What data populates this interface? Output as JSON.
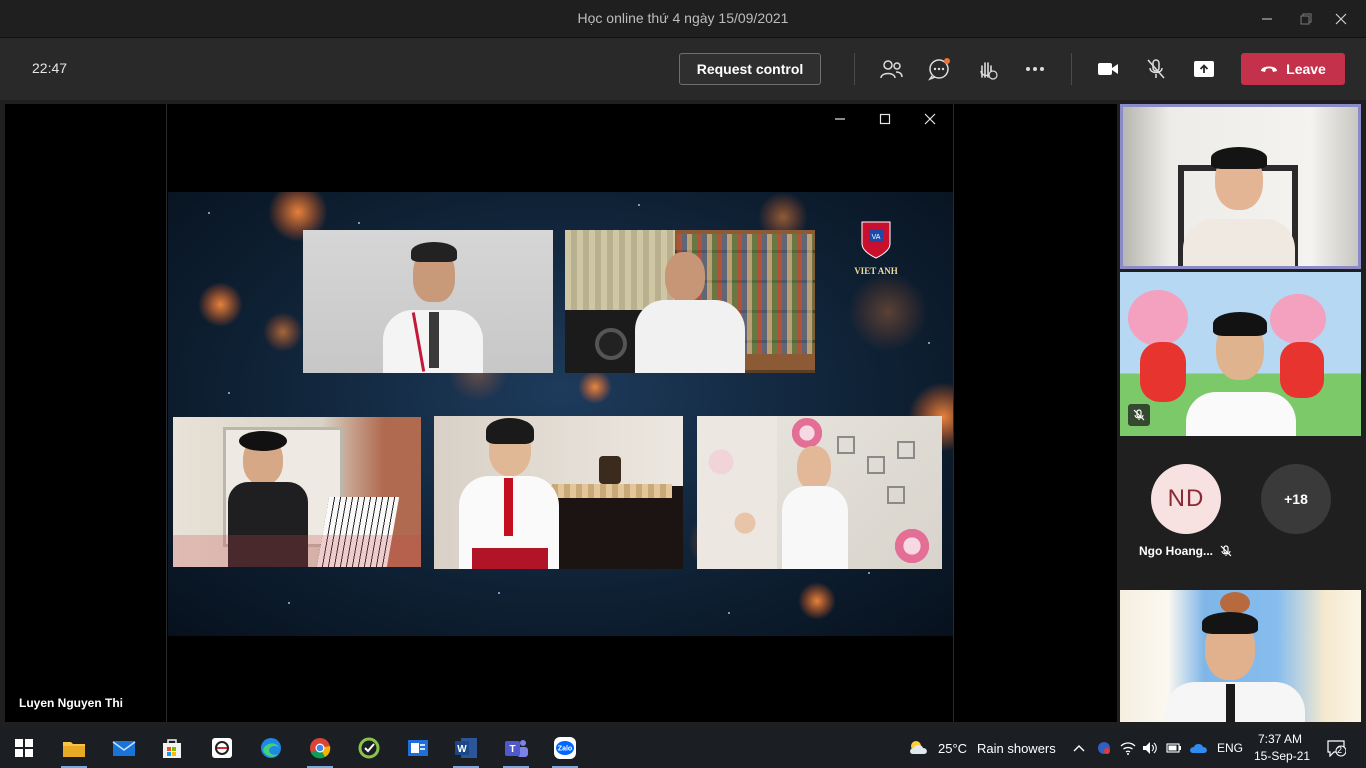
{
  "window": {
    "title": "Học online thứ 4 ngày 15/09/2021"
  },
  "toolbar": {
    "timer": "22:47",
    "request_control_label": "Request control",
    "leave_label": "Leave"
  },
  "stage": {
    "speaker_name": "Luyen Nguyen Thi",
    "shared_video": {
      "logo_text": "VIET ANH"
    }
  },
  "participants": {
    "avatar_initials": "ND",
    "avatar_name": "Ngo Hoang...",
    "overflow_count": "+18"
  },
  "taskbar": {
    "weather_temp": "25°C",
    "weather_desc": "Rain showers",
    "language": "ENG",
    "time": "7:37 AM",
    "date": "15-Sep-21",
    "notification_count": "2"
  },
  "colors": {
    "leave_button": "#c4314b",
    "active_tile_border": "#8b8cc7",
    "avatar_bg": "#f7e1e1",
    "avatar_text": "#8a2a35",
    "overflow_bg": "#3a3a3a"
  }
}
